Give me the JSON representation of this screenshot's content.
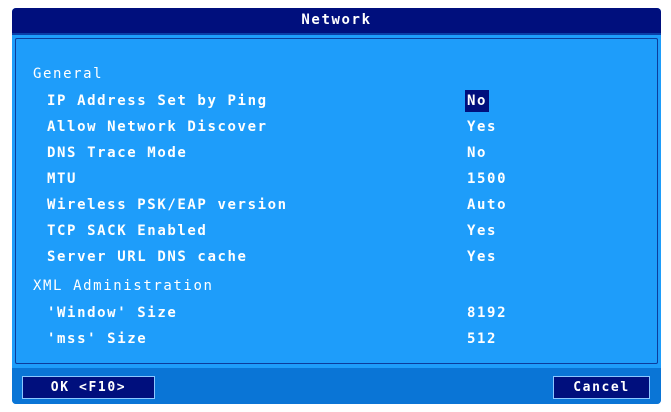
{
  "title": "Network",
  "sections": [
    {
      "name": "General",
      "rows": [
        {
          "label": "IP Address Set by Ping",
          "value": "No",
          "selected": true
        },
        {
          "label": "Allow Network Discover",
          "value": "Yes"
        },
        {
          "label": "DNS Trace Mode",
          "value": "No"
        },
        {
          "label": "MTU",
          "value": "1500"
        },
        {
          "label": "Wireless PSK/EAP version",
          "value": "Auto"
        },
        {
          "label": "TCP SACK Enabled",
          "value": "Yes"
        },
        {
          "label": "Server URL DNS cache",
          "value": "Yes"
        }
      ]
    },
    {
      "name": "XML Administration",
      "rows": [
        {
          "label": "'Window' Size",
          "value": "8192"
        },
        {
          "label": "'mss' Size",
          "value": "512"
        }
      ]
    }
  ],
  "buttons": {
    "ok": "OK <F10>",
    "cancel": "Cancel"
  },
  "colors": {
    "dialog_background": "#1e9dfa",
    "title_bar": "#000f7d",
    "footer": "#0a75d6",
    "selected_value_background": "#000f7d",
    "text": "#ffffff"
  }
}
